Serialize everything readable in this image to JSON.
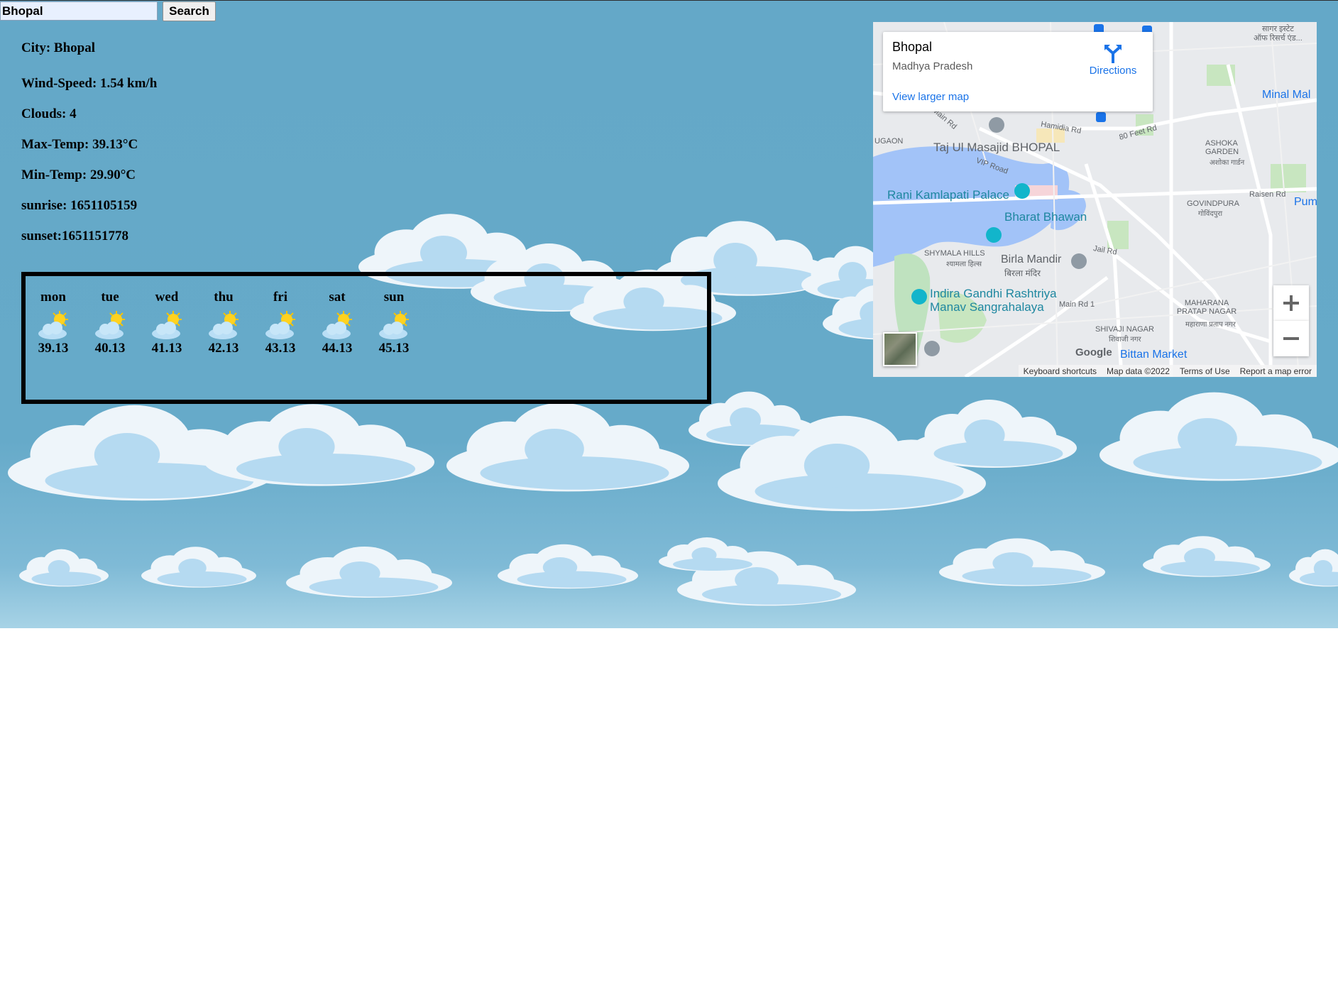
{
  "search": {
    "value": "Bhopal",
    "button_label": "Search"
  },
  "weather": {
    "city": "City: Bhopal",
    "wind": "Wind-Speed: 1.54 km/h",
    "clouds": "Clouds: 4",
    "max_temp": "Max-Temp: 39.13°C",
    "min_temp": "Min-Temp: 29.90°C",
    "sunrise": "sunrise: 1651105159",
    "sunset": "sunset:1651151778"
  },
  "forecast": [
    {
      "day": "mon",
      "temp": "39.13",
      "icon": "partly-sunny-icon"
    },
    {
      "day": "tue",
      "temp": "40.13",
      "icon": "partly-sunny-icon"
    },
    {
      "day": "wed",
      "temp": "41.13",
      "icon": "partly-sunny-icon"
    },
    {
      "day": "thu",
      "temp": "42.13",
      "icon": "partly-sunny-icon"
    },
    {
      "day": "fri",
      "temp": "43.13",
      "icon": "partly-sunny-icon"
    },
    {
      "day": "sat",
      "temp": "44.13",
      "icon": "partly-sunny-icon"
    },
    {
      "day": "sun",
      "temp": "45.13",
      "icon": "partly-sunny-icon"
    }
  ],
  "map": {
    "place_name": "Bhopal",
    "place_region": "Madhya Pradesh",
    "directions_label": "Directions",
    "larger_map_label": "View larger map",
    "zoom_in": "+",
    "zoom_out": "−",
    "labels": {
      "taj": "Taj Ul Masajid BHOPAL",
      "rani": "Rani Kamlapati Palace",
      "bharat": "Bharat Bhawan",
      "birla": "Birla Mandir",
      "birla_hi": "बिरला मंदिर",
      "indira1": "Indira Gandhi Rashtriya",
      "indira2": "Manav Sangrahalaya",
      "shymala": "SHYMALA HILLS",
      "shymala_hi": "श्यामला हिल्स",
      "ashoka": "ASHOKA GARDEN",
      "ashoka_hi": "अशोका गार्डन",
      "govindpura": "GOVINDPURA",
      "govindpura_hi": "गोविंदपुरा",
      "maharana": "MAHARANA PRATAP NAGAR",
      "maharana_hi": "महाराणा प्रताप नगर",
      "shivaji": "SHIVAJI NAGAR",
      "shivaji_hi": "शिवाजी नगर",
      "bittan": "Bittan Market",
      "minal": "Minal Mal",
      "hamidia": "Hamidia Rd",
      "feet80": "80 Feet Rd",
      "vip": "VIP Road",
      "jail": "Jail Rd",
      "main1": "Main Rd 1",
      "raisen": "Raisen Rd",
      "ugaon": "UGAON",
      "main_rd": "Main Rd",
      "pum": "Pum",
      "sagar": "सागर इस्टेट",
      "sagar2": "ऑफ रिसर्च एंड..."
    },
    "footer": {
      "shortcuts": "Keyboard shortcuts",
      "mapdata": "Map data ©2022",
      "terms": "Terms of Use",
      "report": "Report a map error"
    },
    "google_logo": "Google"
  }
}
